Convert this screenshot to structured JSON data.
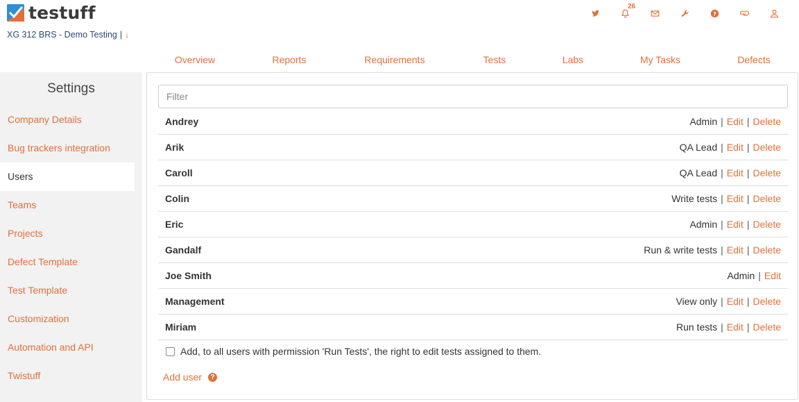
{
  "brand": {
    "name": "testuff",
    "accent": "#e2703a",
    "logo_blue": "#2e8fd8"
  },
  "project": {
    "name": "XG 312 BRS - Demo Testing",
    "separator": "|"
  },
  "header_icons": [
    {
      "name": "twitter-icon"
    },
    {
      "name": "bell-icon",
      "badge": "26"
    },
    {
      "name": "mail-icon"
    },
    {
      "name": "wrench-icon"
    },
    {
      "name": "help-icon"
    },
    {
      "name": "handshake-icon"
    },
    {
      "name": "user-icon"
    }
  ],
  "nav": {
    "tabs": [
      "Overview",
      "Reports",
      "Requirements",
      "Tests",
      "Labs",
      "My Tasks",
      "Defects"
    ]
  },
  "sidebar": {
    "title": "Settings",
    "items": [
      {
        "label": "Company Details",
        "active": false
      },
      {
        "label": "Bug trackers integration",
        "active": false
      },
      {
        "label": "Users",
        "active": true
      },
      {
        "label": "Teams",
        "active": false
      },
      {
        "label": "Projects",
        "active": false
      },
      {
        "label": "Defect Template",
        "active": false
      },
      {
        "label": "Test Template",
        "active": false
      },
      {
        "label": "Customization",
        "active": false
      },
      {
        "label": "Automation and API",
        "active": false
      },
      {
        "label": "Twistuff",
        "active": false
      }
    ]
  },
  "main": {
    "filter_placeholder": "Filter",
    "edit_label": "Edit",
    "delete_label": "Delete",
    "users": [
      {
        "name": "Andrey",
        "role": "Admin",
        "can_delete": true
      },
      {
        "name": "Arik",
        "role": "QA Lead",
        "can_delete": true
      },
      {
        "name": "Caroll",
        "role": "QA Lead",
        "can_delete": true
      },
      {
        "name": "Colin",
        "role": "Write tests",
        "can_delete": true
      },
      {
        "name": "Eric",
        "role": "Admin",
        "can_delete": true
      },
      {
        "name": "Gandalf",
        "role": "Run & write tests",
        "can_delete": true
      },
      {
        "name": "Joe Smith",
        "role": "Admin",
        "can_delete": false
      },
      {
        "name": "Management",
        "role": "View only",
        "can_delete": true
      },
      {
        "name": "Miriam",
        "role": "Run tests",
        "can_delete": true
      }
    ],
    "checkbox_label": "Add, to all users with permission 'Run Tests', the right to edit tests assigned to them.",
    "add_user_label": "Add user"
  }
}
